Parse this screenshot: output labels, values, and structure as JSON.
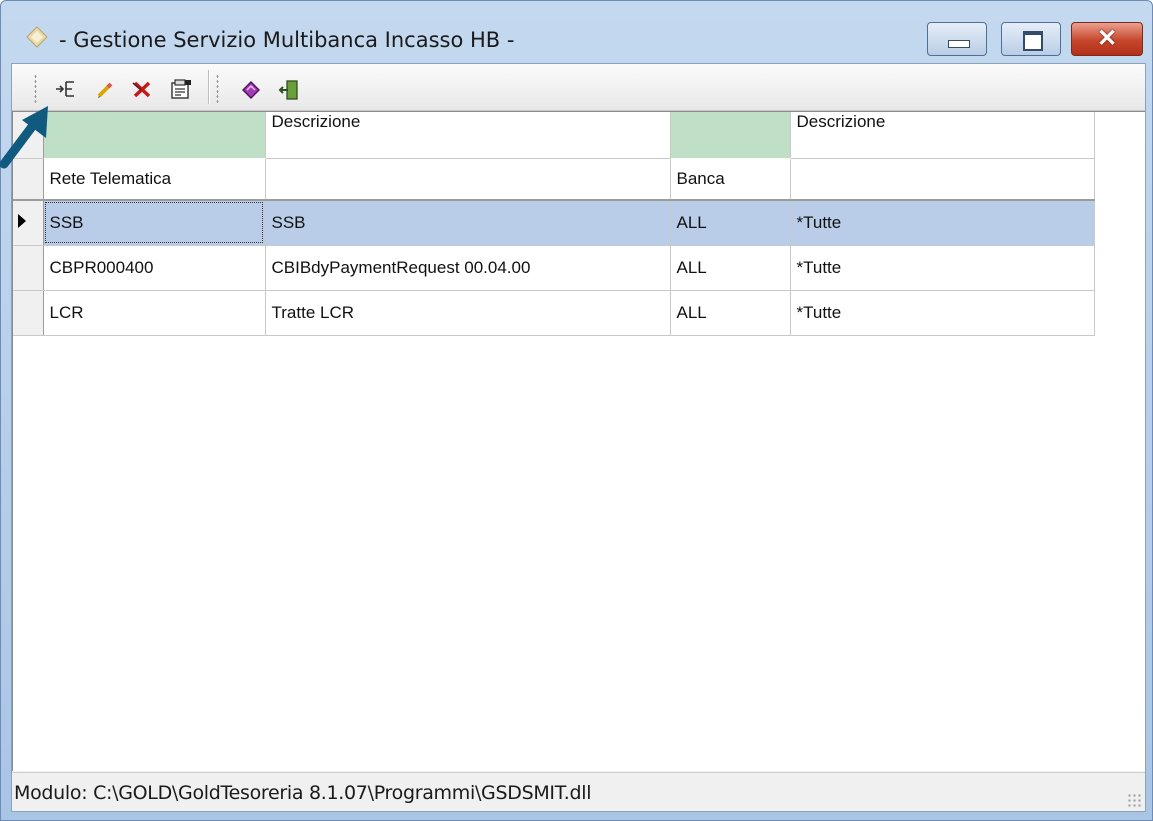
{
  "window": {
    "title": "- Gestione Servizio Multibanca Incasso HB -"
  },
  "toolbar": {
    "buttons": [
      {
        "name": "insert-icon",
        "glyph": "⇥"
      },
      {
        "name": "edit-icon",
        "glyph": "✎"
      },
      {
        "name": "delete-icon",
        "glyph": "✖"
      },
      {
        "name": "properties-icon",
        "glyph": "▦"
      },
      {
        "name": "book-icon",
        "glyph": "◆"
      },
      {
        "name": "exit-icon",
        "glyph": "⇤"
      }
    ]
  },
  "grid": {
    "header_top": [
      "",
      "Descrizione",
      "",
      "Descrizione"
    ],
    "header_bottom": [
      "Rete Telematica",
      "",
      "Banca",
      ""
    ],
    "rows": [
      {
        "rete": "SSB",
        "descrizione": "SSB",
        "banca": "ALL",
        "descrizione_banca": "*Tutte"
      },
      {
        "rete": "CBPR000400",
        "descrizione": "CBIBdyPaymentRequest 00.04.00",
        "banca": "ALL",
        "descrizione_banca": "*Tutte"
      },
      {
        "rete": "LCR",
        "descrizione": "Tratte LCR",
        "banca": "ALL",
        "descrizione_banca": "*Tutte"
      }
    ],
    "selected_row": 0
  },
  "status": {
    "text": "Modulo: C:\\GOLD\\GoldTesoreria 8.1.07\\Programmi\\GSDSMIT.dll"
  },
  "colors": {
    "selection": "#b9cde8",
    "filter_cell": "#bfe0c7",
    "annotation_arrow": "#0f5a7e"
  }
}
